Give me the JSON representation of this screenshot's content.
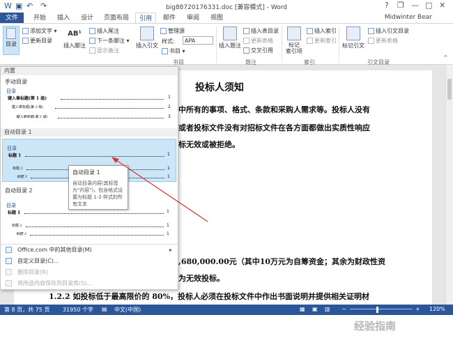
{
  "window": {
    "title": "big88720176331.doc [兼容模式] - Word",
    "user": "Midwinter Bear",
    "help": "?",
    "restore": "❐",
    "minimize": "—",
    "maximize": "□",
    "close": "✕"
  },
  "tabs": [
    {
      "label": "文件"
    },
    {
      "label": "开始"
    },
    {
      "label": "插入"
    },
    {
      "label": "设计"
    },
    {
      "label": "页面布局"
    },
    {
      "label": "引用"
    },
    {
      "label": "邮件"
    },
    {
      "label": "审阅"
    },
    {
      "label": "视图"
    }
  ],
  "ribbon": {
    "toc_button": "目录",
    "add_text": "添加文字 ▾",
    "update_toc": "更新目录",
    "insert_footnote": "插入脚注",
    "insert_endnote": "插入尾注",
    "next_footnote": "下一条脚注 ▾",
    "show_notes": "显示备注",
    "insert_citation": "插入引文",
    "manage_sources": "管理源",
    "style_label": "样式:",
    "style_value": "APA",
    "bibliography": "书目 ▾",
    "insert_caption": "插入题注",
    "insert_table_of_figures": "插入表目录",
    "update_table": "更新表格",
    "cross_reference": "交叉引用",
    "mark_entry": "标记\n索引项",
    "insert_index": "插入索引",
    "update_index": "更新索引",
    "mark_citation": "标记引文",
    "insert_table_of_authorities": "插入引文目录",
    "update_table2": "更新表格",
    "group_captions": "题注",
    "group_index": "索引",
    "group_authorities": "引文目录",
    "group_bib": "书目"
  },
  "dropdown": {
    "section_builtin": "内置",
    "manual_title": "手动目录",
    "manual_toc_label": "目录",
    "manual_entries": [
      "键入章标题(第 1 级)",
      "键入章标题(第 2 级)",
      "键入章标题(第 3 级)"
    ],
    "auto1_title": "自动目录 1",
    "auto1_label": "目录",
    "auto2_title": "自动目录 2",
    "auto2_label": "目录",
    "entries": [
      "标题 1",
      "标题 2",
      "标题 3"
    ],
    "page_nums": [
      "1",
      "1",
      "1"
    ],
    "manual_nums": [
      "1",
      "2",
      "3"
    ],
    "menu": [
      {
        "label": "Office.com 中的其他目录(M)",
        "arrow": "▸",
        "disabled": false
      },
      {
        "label": "自定义目录(C)...",
        "arrow": "",
        "disabled": false
      },
      {
        "label": "删除目录(R)",
        "arrow": "",
        "disabled": true
      },
      {
        "label": "将所选内容保存到目录库(S)...",
        "arrow": "",
        "disabled": true
      }
    ]
  },
  "tooltip": {
    "title": "自动目录 1",
    "desc": "自动目录内容(其标签为\"内容\")，包含格式设置为标题 1-3 样式的所有文本"
  },
  "document": {
    "title": "投标人须知",
    "lines": [
      "中所有的事项、格式、条款和采购人需求等。投标人没有",
      "或者投标文件没有对招标文件在各方面都做出实质性响应",
      "标无效或被拒绝。",
      ",680,000.00元（其中10万元为自筹资金；其余为财政性资",
      "为无效投标。",
      "1.2.2 如投标低于最高限价的 80%，投标人必须在投标文件中作出书面说明并提供相关证明材"
    ]
  },
  "status": {
    "page": "第 8 页，共 75 页",
    "words": "31950 个字",
    "lang": "中文(中国)",
    "zoom": "120%"
  },
  "watermark": "经验指南"
}
